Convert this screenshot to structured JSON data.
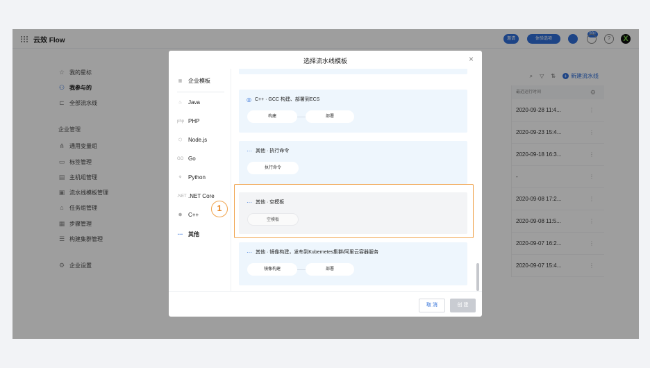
{
  "app": {
    "title": "云效 Flow",
    "badges": {
      "invite": "邀请",
      "trial": "体验选项",
      "count": "99+"
    }
  },
  "sidebar": {
    "items": [
      {
        "label": "我的星标",
        "icon": "star-icon"
      },
      {
        "label": "我参与的",
        "icon": "user-icon"
      },
      {
        "label": "全部流水线",
        "icon": "pipeline-icon"
      }
    ],
    "group_label": "企业管理",
    "admin_items": [
      {
        "label": "通用变量组",
        "icon": "variable-icon"
      },
      {
        "label": "标签管理",
        "icon": "tag-icon"
      },
      {
        "label": "主机组管理",
        "icon": "host-icon"
      },
      {
        "label": "流水线模板管理",
        "icon": "template-icon"
      },
      {
        "label": "任务组管理",
        "icon": "task-icon"
      },
      {
        "label": "步骤管理",
        "icon": "step-icon"
      },
      {
        "label": "构建集群管理",
        "icon": "cluster-icon"
      }
    ],
    "settings_label": "企业设置"
  },
  "main": {
    "new_pipeline": "新建流水线",
    "column_last_run": "最近运行时间",
    "rows": [
      "2020-09-28 11:4...",
      "2020-09-23 15:4...",
      "2020-09-18 16:3...",
      "-",
      "2020-09-08 17:2...",
      "2020-09-08 11:5...",
      "2020-09-07 16:2...",
      "2020-09-07 15:4..."
    ]
  },
  "modal": {
    "title": "选择流水线模板",
    "languages": [
      {
        "label": "企业模板",
        "icon": "enterprise-icon"
      },
      {
        "label": "Java",
        "icon": "java-icon"
      },
      {
        "label": "PHP",
        "icon": "php-icon"
      },
      {
        "label": "Node.js",
        "icon": "nodejs-icon"
      },
      {
        "label": "Go",
        "icon": "go-icon"
      },
      {
        "label": "Python",
        "icon": "python-icon"
      },
      {
        "label": ".NET Core",
        "icon": "dotnet-icon"
      },
      {
        "label": "C++",
        "icon": "cpp-icon"
      },
      {
        "label": "其他",
        "icon": "more-icon"
      }
    ],
    "templates": [
      {
        "title": "C++ · GCC 构建、部署到ECS",
        "steps": [
          "构建",
          "部署"
        ]
      },
      {
        "title": "其他 · 执行命令",
        "steps": [
          "执行命令"
        ]
      },
      {
        "title": "其他 · 空模板",
        "steps": [
          "空模板"
        ]
      },
      {
        "title": "其他 · 镜像构建，发布到Kubernetes集群/阿里云容器服务",
        "steps": [
          "镜像构建",
          "部署"
        ]
      }
    ],
    "annotation": "1",
    "cancel_label": "取 消",
    "create_label": "创 建"
  },
  "colors": {
    "accent": "#2f6fd8",
    "highlight": "#f0a24a",
    "card_bg": "#eef6fd"
  }
}
